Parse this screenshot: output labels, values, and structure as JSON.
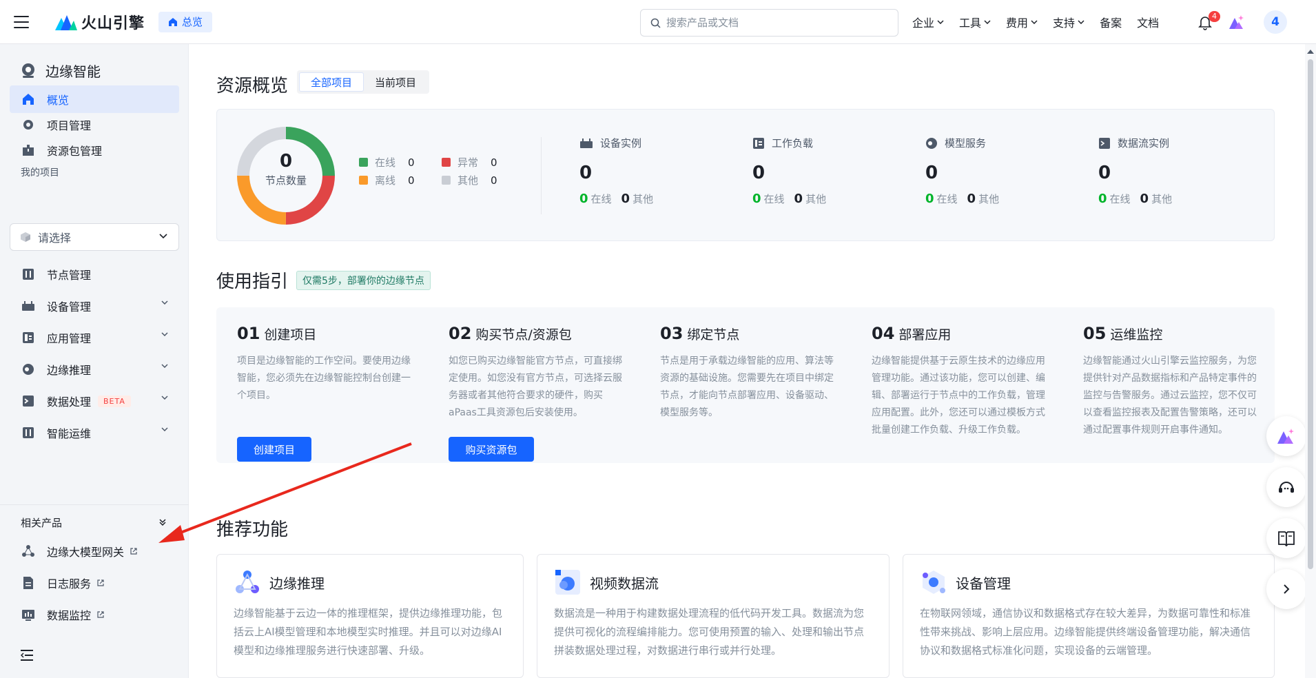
{
  "header": {
    "brand": "火山引擎",
    "breadcrumb": "总览",
    "search_placeholder": "搜索产品或文档",
    "nav": [
      {
        "label": "企业",
        "dropdown": true
      },
      {
        "label": "工具",
        "dropdown": true
      },
      {
        "label": "费用",
        "dropdown": true
      },
      {
        "label": "支持",
        "dropdown": true
      },
      {
        "label": "备案",
        "dropdown": false
      },
      {
        "label": "文档",
        "dropdown": false
      }
    ],
    "notification_count": "4",
    "avatar_text": "4"
  },
  "sidebar": {
    "title": "边缘智能",
    "top_items": [
      {
        "label": "概览",
        "icon": "home-icon",
        "active": true
      },
      {
        "label": "项目管理",
        "icon": "gear-icon"
      },
      {
        "label": "资源包管理",
        "icon": "package-icon"
      }
    ],
    "my_projects_label": "我的项目",
    "project_select": "请选择",
    "items": [
      {
        "label": "节点管理",
        "icon": "node-icon"
      },
      {
        "label": "设备管理",
        "icon": "device-icon"
      },
      {
        "label": "应用管理",
        "icon": "app-icon"
      },
      {
        "label": "边缘推理",
        "icon": "inference-icon"
      },
      {
        "label": "数据处理",
        "icon": "data-icon",
        "badge": "BETA"
      },
      {
        "label": "智能运维",
        "icon": "ops-icon"
      }
    ],
    "related_label": "相关产品",
    "related": [
      {
        "label": "边缘大模型网关",
        "icon": "gateway-icon"
      },
      {
        "label": "日志服务",
        "icon": "log-icon"
      },
      {
        "label": "数据监控",
        "icon": "monitor-icon"
      }
    ]
  },
  "overview": {
    "title": "资源概览",
    "tabs": [
      "全部项目",
      "当前项目"
    ],
    "active_tab": 0,
    "donut": {
      "value": "0",
      "label": "节点数量"
    },
    "legend": [
      {
        "label": "在线",
        "value": "0",
        "color": "#3aa35c"
      },
      {
        "label": "异常",
        "value": "0",
        "color": "#e04545"
      },
      {
        "label": "离线",
        "value": "0",
        "color": "#fa9a2a"
      },
      {
        "label": "其他",
        "value": "0",
        "color": "#c9cdd4"
      }
    ],
    "stats": [
      {
        "label": "设备实例",
        "icon": "device-icon",
        "total": "0",
        "online": "0",
        "online_label": "在线",
        "other": "0",
        "other_label": "其他"
      },
      {
        "label": "工作负载",
        "icon": "workload-icon",
        "total": "0",
        "online": "0",
        "online_label": "在线",
        "other": "0",
        "other_label": "其他"
      },
      {
        "label": "模型服务",
        "icon": "model-icon",
        "total": "0",
        "online": "0",
        "online_label": "在线",
        "other": "0",
        "other_label": "其他"
      },
      {
        "label": "数据流实例",
        "icon": "dataflow-icon",
        "total": "0",
        "online": "0",
        "online_label": "在线",
        "other": "0",
        "other_label": "其他"
      }
    ]
  },
  "guide": {
    "title": "使用指引",
    "tag": "仅需5步，部署你的边缘节点",
    "steps": [
      {
        "num": "01",
        "title": "创建项目",
        "desc": "项目是边缘智能的工作空间。要使用边缘智能，您必须先在边缘智能控制台创建一个项目。",
        "button": "创建项目"
      },
      {
        "num": "02",
        "title": "购买节点/资源包",
        "desc": "如您已购买边缘智能官方节点，可直接绑定使用。如您没有官方节点，可选择云服务器或者其他符合要求的硬件，购买aPaas工具资源包后安装使用。",
        "button": "购买资源包"
      },
      {
        "num": "03",
        "title": "绑定节点",
        "desc": "节点是用于承载边缘智能的应用、算法等资源的基础设施。您需要先在项目中绑定节点，才能向节点部署应用、设备驱动、模型服务等。"
      },
      {
        "num": "04",
        "title": "部署应用",
        "desc": "边缘智能提供基于云原生技术的边缘应用管理功能。通过该功能，您可以创建、编辑、部署运行于节点中的工作负载，管理应用配置。此外，您还可以通过模板方式批量创建工作负载、升级工作负载。"
      },
      {
        "num": "05",
        "title": "运维监控",
        "desc": "边缘智能通过火山引擎云监控服务，为您提供针对产品数据指标和产品特定事件的监控与告警服务。通过云监控，您不仅可以查看监控报表及配置告警策略，还可以通过配置事件规则开启事件通知。"
      }
    ]
  },
  "recommend": {
    "title": "推荐功能",
    "cards": [
      {
        "title": "边缘推理",
        "desc": "边缘智能基于云边一体的推理框架，提供边缘推理功能，包括云上AI模型管理和本地模型实时推理。并且可以对边缘AI模型和边缘推理服务进行快速部署、升级。"
      },
      {
        "title": "视频数据流",
        "desc": "数据流是一种用于构建数据处理流程的低代码开发工具。数据流为您提供可视化的流程编排能力。您可使用预置的输入、处理和输出节点拼装数据处理过程，对数据进行串行或并行处理。"
      },
      {
        "title": "设备管理",
        "desc": "在物联网领域，通信协议和数据格式存在较大差异，为数据可靠性和标准性带来挑战、影响上层应用。边缘智能提供终端设备管理功能，解决通信协议和数据格式标准化问题，实现设备的云端管理。"
      }
    ]
  },
  "colors": {
    "accent": "#1664ff",
    "online": "#00b42a",
    "annotation_arrow": "#e8281d"
  }
}
